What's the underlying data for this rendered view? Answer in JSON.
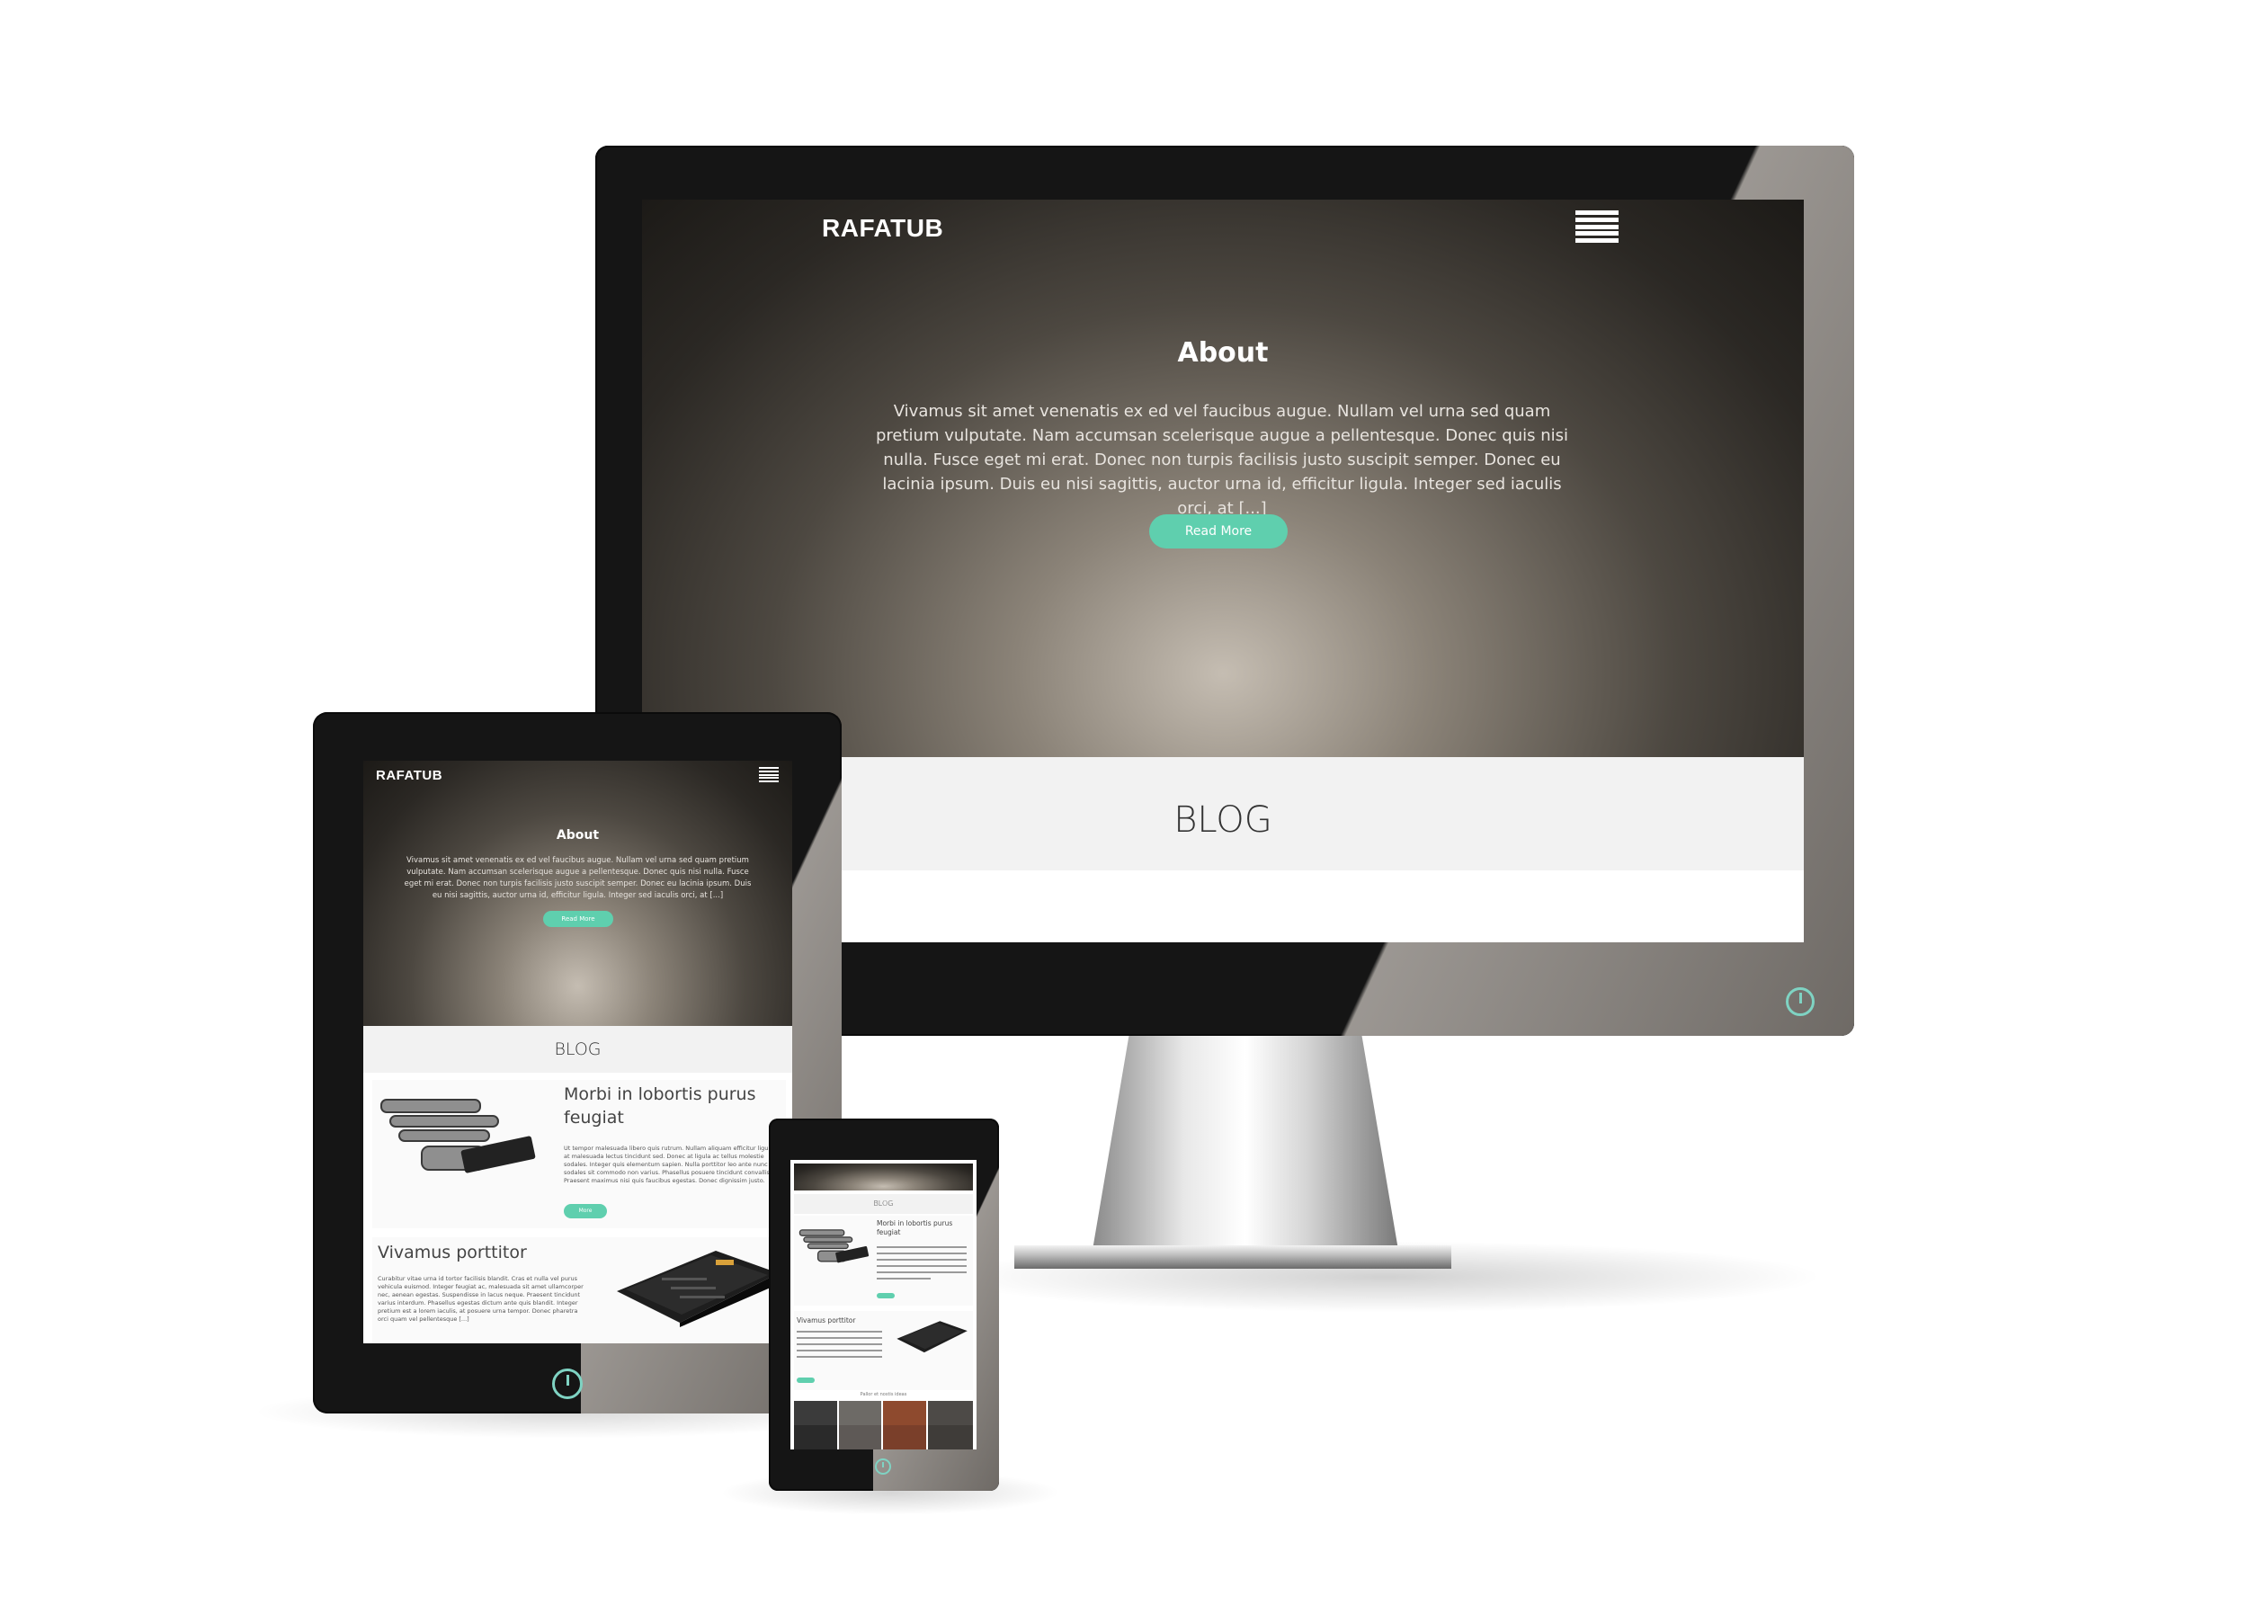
{
  "site": {
    "logo": "RAFATUB",
    "about_title": "About",
    "about_text": "Vivamus sit amet venenatis ex ed vel faucibus augue. Nullam vel urna sed quam pretium vulputate. Nam accumsan scelerisque augue a pellentesque. Donec quis nisi nulla. Fusce eget mi erat. Donec non turpis facilisis justo suscipit semper. Donec eu lacinia ipsum. Duis eu nisi sagittis, auctor urna id, efficitur ligula. Integer sed iaculis orci, at [...]",
    "read_more": "Read More",
    "blog_heading": "BLOG"
  },
  "posts": [
    {
      "title": "Morbi in lobortis purus feugiat",
      "excerpt": "Ut tempor malesuada libero quis rutrum. Nullam aliquam efficitur ligula, at malesuada lectus tincidunt sed. Donec at ligula ac tellus molestie sodales. Integer quis elementum sapien. Nulla porttitor leo ante nunc sodales sit commodo non varius. Phasellus posuere tincidunt convallis. Praesent maximus nisi quis faucibus egestas. Donec dignissim justo.",
      "button": "More"
    },
    {
      "title": "Vivamus porttitor",
      "excerpt": "Curabitur vitae urna id tortor facilisis blandit. Cras et nulla vel purus vehicula euismod. Integer feugiat ac, malesuada sit amet ullamcorper nec, aenean egestas. Suspendisse in lacus neque. Praesent tincidunt varius interdum. Phasellus egestas dictum ante quis blandit. Integer pretium est a lorem iaculis, at posuere urna tempor. Donec pharetra orci quam vel pellentesque [...]",
      "button": "More"
    }
  ],
  "phone": {
    "footer_caption": "Pallor et nostis ideas"
  },
  "colors": {
    "accent": "#5fcfae",
    "power_ring": "#7fd3c3"
  },
  "icons": {
    "menu": "hamburger-menu-icon",
    "power": "power-icon"
  }
}
